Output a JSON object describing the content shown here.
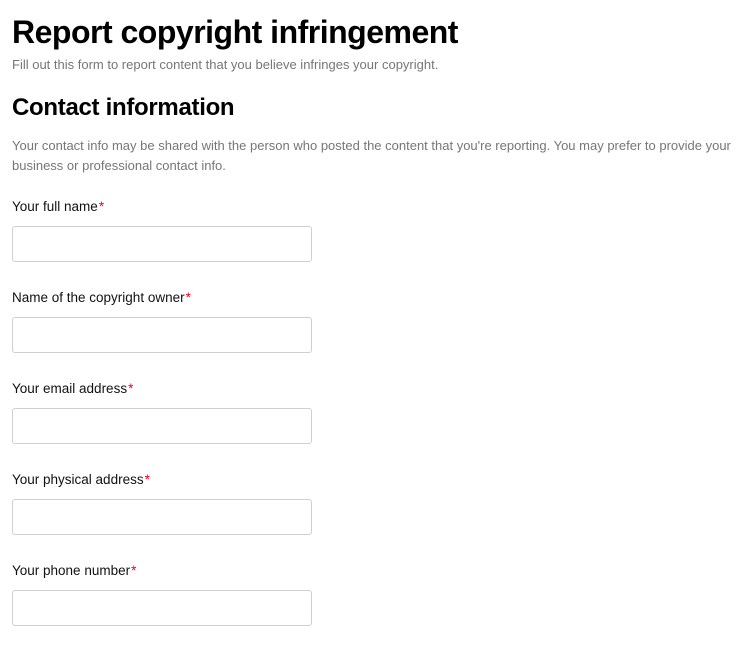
{
  "page_title": "Report copyright infringement",
  "page_subtitle": "Fill out this form to report content that you believe infringes your copyright.",
  "section_heading": "Contact information",
  "section_desc": "Your contact info may be shared with the person who posted the content that you're reporting. You may prefer to provide your business or professional contact info.",
  "required_marker": "*",
  "fields": {
    "full_name": {
      "label": "Your full name",
      "value": ""
    },
    "owner_name": {
      "label": "Name of the copyright owner",
      "value": ""
    },
    "email": {
      "label": "Your email address",
      "value": ""
    },
    "physical_address": {
      "label": "Your physical address",
      "value": ""
    },
    "phone": {
      "label": "Your phone number",
      "value": ""
    }
  }
}
